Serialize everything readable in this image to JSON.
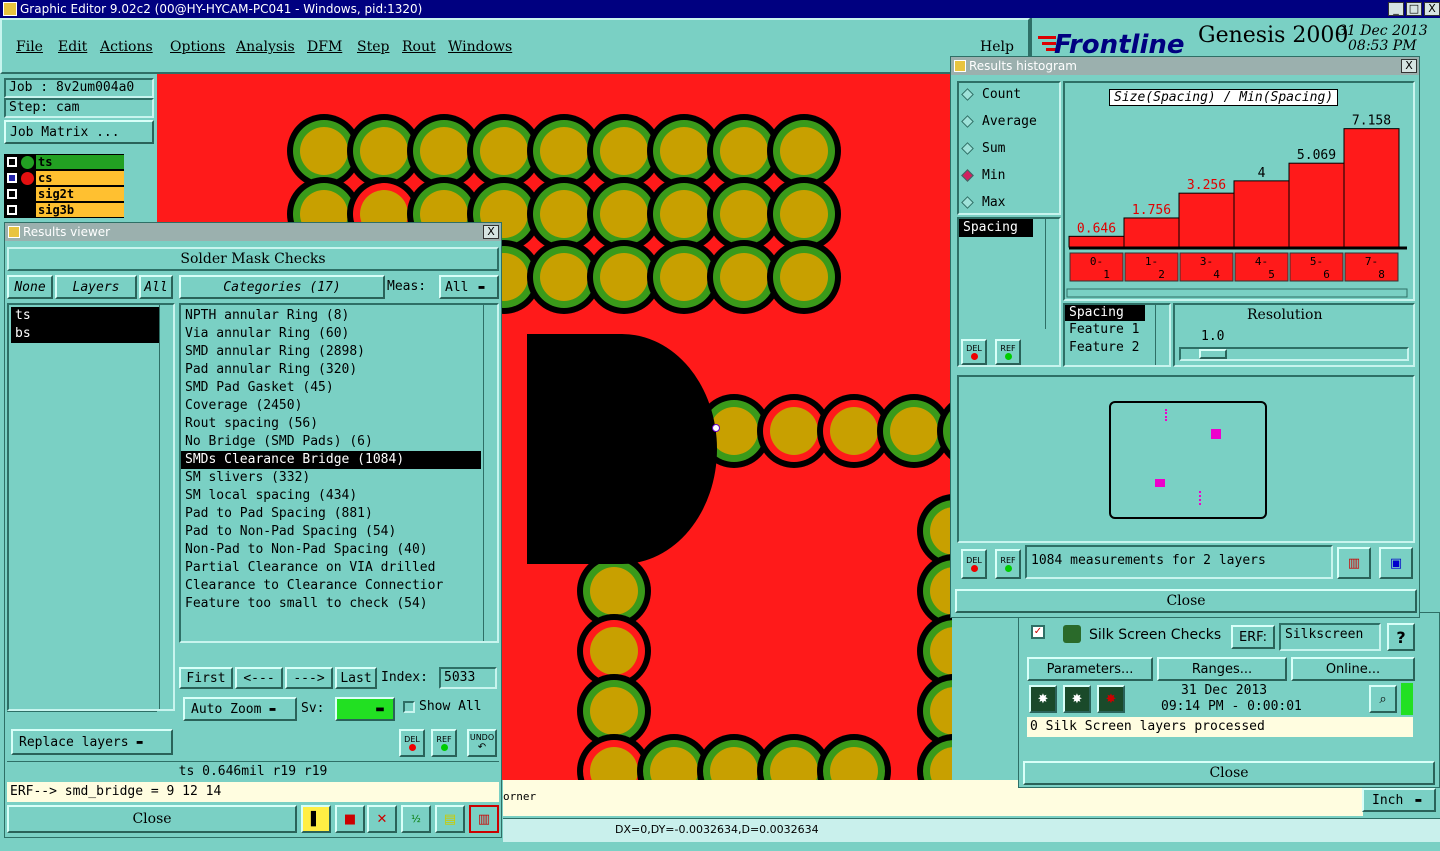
{
  "window": {
    "title": "Graphic Editor 9.02c2 (00@HY-HYCAM-PC041 - Windows, pid:1320)",
    "controls": [
      "_",
      "□",
      "X"
    ]
  },
  "menu": {
    "items": [
      "File",
      "Edit",
      "Actions",
      "Options",
      "Analysis",
      "DFM",
      "Step",
      "Rout",
      "Windows"
    ],
    "help": "Help"
  },
  "brand": {
    "logo": "Frontline",
    "product": "Genesis 2000",
    "date": "31 Dec 2013",
    "time": "08:53 PM"
  },
  "job": {
    "job": "Job : 8v2um004a0",
    "step": "Step: cam",
    "matrix_button": "Job Matrix ..."
  },
  "layers": [
    {
      "name": "ts",
      "color": "#22a022"
    },
    {
      "name": "cs",
      "color": "#e41010"
    },
    {
      "name": "sig2t",
      "color": ""
    },
    {
      "name": "sig3b",
      "color": ""
    }
  ],
  "results_viewer": {
    "title": "Results viewer",
    "header": "Solder Mask Checks",
    "none_btn": "None",
    "layers_btn": "Layers",
    "all_btn": "All",
    "categories_btn": "Categories (17)",
    "meas_label": "Meas:",
    "meas_value": "All",
    "layer_list": [
      "ts",
      "bs"
    ],
    "categories": [
      "NPTH annular Ring (8)",
      "Via annular Ring (60)",
      "SMD annular Ring (2898)",
      "Pad annular Ring (320)",
      "SMD Pad Gasket (45)",
      "Coverage (2450)",
      "Rout spacing (56)",
      "No Bridge (SMD Pads) (6)",
      "SMDs Clearance Bridge (1084)",
      "SM slivers (332)",
      "SM local spacing (434)",
      "Pad to Pad Spacing (881)",
      "Pad to Non-Pad Spacing (54)",
      "Non-Pad to Non-Pad Spacing (40)",
      "Partial Clearance on VIA drilled",
      "Clearance to Clearance Connectior",
      "Feature too small to check (54)"
    ],
    "selected_index": 8,
    "first_btn": "First",
    "prev_btn": "<---",
    "next_btn": "--->",
    "last_btn": "Last",
    "index_label": "Index:",
    "index_value": "5033",
    "autozoom": "Auto Zoom",
    "sv_label": "Sv:",
    "show_all": "Show All",
    "replace_layers": "Replace layers",
    "del": "DEL",
    "ref": "REF",
    "undo": "UNDO",
    "status": "ts 0.646mil  r19  r19",
    "erf_line": "ERF--> smd_bridge = 9 12 14",
    "close": "Close"
  },
  "histogram": {
    "title": "Results histogram",
    "options": [
      "Count",
      "Average",
      "Sum",
      "Min",
      "Max"
    ],
    "selected_option": "Min",
    "chart_title": "Size(Spacing) / Min(Spacing)",
    "field_list": [
      "Spacing"
    ],
    "del": "DEL",
    "ref": "REF",
    "attr_list": [
      "Spacing",
      "Feature 1",
      "Feature 2"
    ],
    "resolution_label": "Resolution",
    "resolution_value": "1.0",
    "measurements": "1084 measurements for 2 layers",
    "close": "Close"
  },
  "chart_data": {
    "type": "bar",
    "title": "Size(Spacing) / Min(Spacing)",
    "categories": [
      "0-1",
      "1-2",
      "3-4",
      "4-5",
      "5-6",
      "7-8"
    ],
    "values": [
      0.646,
      1.756,
      3.256,
      4,
      5.069,
      7.158
    ],
    "labels": [
      "0.646",
      "1.756",
      "3.256",
      "4",
      "5.069",
      "7.158"
    ],
    "red_labels": [
      true,
      true,
      true,
      false,
      false,
      false
    ],
    "ylim": [
      0,
      7.5
    ]
  },
  "silk": {
    "title": "Silk Screen Checks",
    "erf_label": "ERF:",
    "erf_value": "Silkscreen",
    "help": "?",
    "params": "Parameters...",
    "ranges": "Ranges...",
    "online": "Online...",
    "date": "31 Dec 2013",
    "time": "09:14 PM - 0:00:01",
    "status": "0 Silk Screen layers processed",
    "close": "Close"
  },
  "bottom": {
    "corner": "orner",
    "units": "Inch",
    "coords": "DX=0,DY=-0.0032634,D=0.0032634"
  },
  "colors": {
    "board": "#ff1a1a",
    "pad": "#c8a000",
    "ring": "#3a9a1a",
    "panel": "#7ad0c4",
    "title_blue": "#000080"
  }
}
